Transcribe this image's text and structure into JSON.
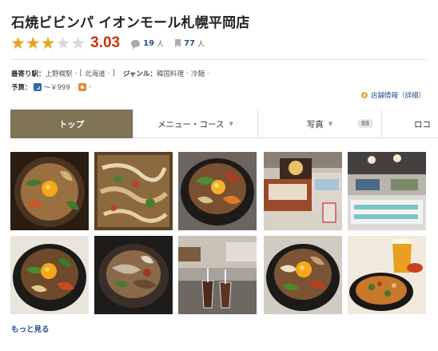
{
  "restaurant": {
    "name": "石焼ビビンパ イオンモール札幌平岡店",
    "score": "3.03",
    "stars_filled": 3,
    "stars_total": 5,
    "reviews": {
      "count": "19",
      "unit": "人"
    },
    "bookmarks": {
      "count": "77",
      "unit": "人"
    }
  },
  "info": {
    "station_label": "最寄り駅：",
    "station": "上野幌駅",
    "bracket_open": "[",
    "area": "北海道",
    "bracket_close": "]",
    "genre_label": "ジャンル：",
    "genre1": "韓国料理",
    "genre2": "冷麺",
    "budget_label": "予算：",
    "dinner_budget": "～￥999",
    "lunch_budget": "-",
    "dash": "-",
    "store_info_link": "店舗情報（詳細）"
  },
  "tabs": [
    {
      "label": "トップ"
    },
    {
      "label": "メニュー・コース"
    },
    {
      "label": "写真",
      "badge": "88"
    },
    {
      "label": "ロコ"
    }
  ],
  "photos": [
    {
      "desc": "bibimbap-egg"
    },
    {
      "desc": "bibimbap-mixed"
    },
    {
      "desc": "bibimbap-bowl"
    },
    {
      "desc": "restaurant-exterior"
    },
    {
      "desc": "food-court"
    },
    {
      "desc": "bibimbap-egg-2"
    },
    {
      "desc": "bibimbap-meat"
    },
    {
      "desc": "iced-coffee"
    },
    {
      "desc": "bibimbap-egg-3"
    },
    {
      "desc": "beer-pancake"
    }
  ],
  "more_link": "もっと見る",
  "colors": {
    "star": "#e8a317",
    "score": "#cc3300",
    "tab_active": "#807356",
    "link": "#26508c"
  }
}
